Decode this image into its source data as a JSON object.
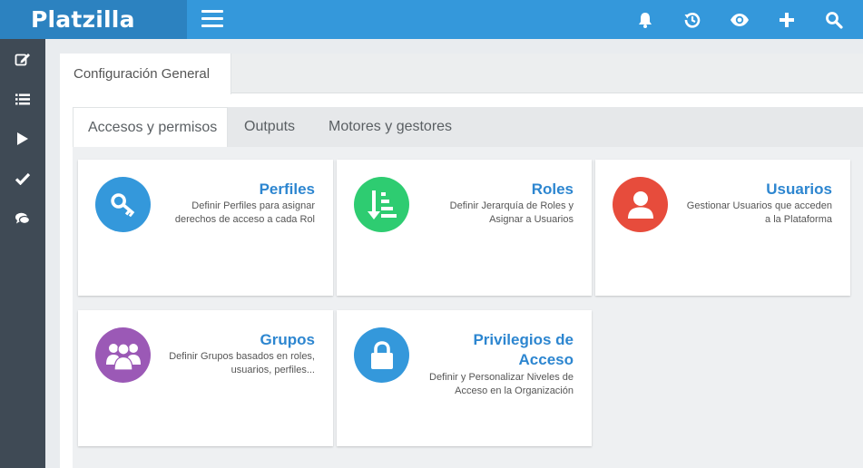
{
  "app": {
    "brand": "Platzilla"
  },
  "topbar": {
    "icons": [
      "bell-icon",
      "history-icon",
      "eye-icon",
      "plus-icon",
      "search-icon"
    ]
  },
  "sidebar": {
    "items": [
      "edit-icon",
      "list-icon",
      "play-icon",
      "check-icon",
      "comments-icon"
    ]
  },
  "panel": {
    "tab_label": "Configuración General"
  },
  "subtabs": [
    {
      "label": "Accesos y permisos",
      "active": true
    },
    {
      "label": "Outputs",
      "active": false
    },
    {
      "label": "Motores y gestores",
      "active": false
    }
  ],
  "cards": [
    {
      "title": "Perfiles",
      "desc_line1": "Definir Perfiles para asignar",
      "desc_line2": "derechos de acceso a cada Rol",
      "icon": "key-icon",
      "color": "#3498db"
    },
    {
      "title": "Roles",
      "desc_line1": "Definir Jerarquía de Roles y",
      "desc_line2": "Asignar a Usuarios",
      "icon": "sort-amount-icon",
      "color": "#2ecc71"
    },
    {
      "title": "Usuarios",
      "desc_line1": "Gestionar Usuarios que acceden",
      "desc_line2": "a la Plataforma",
      "icon": "user-icon",
      "color": "#e74c3c"
    },
    {
      "title": "Grupos",
      "desc_line1": "Definir Grupos basados en roles,",
      "desc_line2": "usuarios, perfiles...",
      "icon": "group-icon",
      "color": "#9b59b6"
    },
    {
      "title_line1": "Privilegios de",
      "title_line2": "Acceso",
      "desc_line1": "Definir y Personalizar Niveles de",
      "desc_line2": "Acceso en la Organización",
      "icon": "lock-icon",
      "color": "#3498db"
    }
  ]
}
